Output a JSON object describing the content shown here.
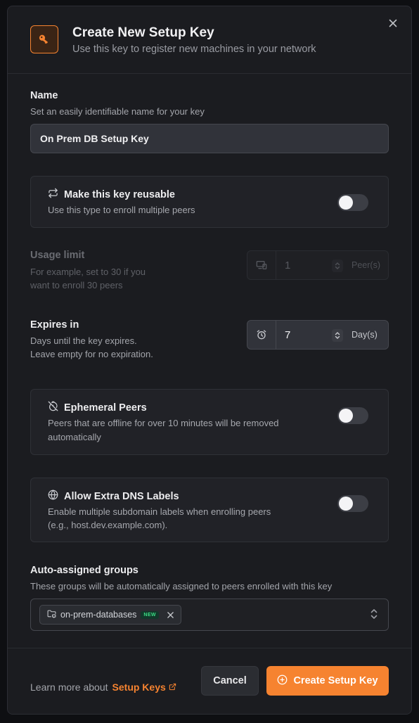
{
  "header": {
    "title": "Create New Setup Key",
    "subtitle": "Use this key to register new machines in your network"
  },
  "name_field": {
    "label": "Name",
    "description": "Set an easily identifiable name for your key",
    "value": "On Prem DB Setup Key"
  },
  "reusable": {
    "title": "Make this key reusable",
    "description": "Use this type to enroll multiple peers",
    "enabled": false
  },
  "usage_limit": {
    "label": "Usage limit",
    "description_line1": "For example, set to 30 if you",
    "description_line2": "want to enroll 30 peers",
    "value": "1",
    "unit": "Peer(s)",
    "disabled": true
  },
  "expires": {
    "label": "Expires in",
    "description_line1": "Days until the key expires.",
    "description_line2": "Leave empty for no expiration.",
    "value": "7",
    "unit": "Day(s)"
  },
  "ephemeral": {
    "title": "Ephemeral Peers",
    "description": "Peers that are offline for over 10 minutes will be removed automatically",
    "enabled": false
  },
  "dns_labels": {
    "title": "Allow Extra DNS Labels",
    "description_line1": "Enable multiple subdomain labels when enrolling peers",
    "description_line2": "(e.g., host.dev.example.com).",
    "enabled": false
  },
  "groups": {
    "label": "Auto-assigned groups",
    "description": "These groups will be automatically assigned to peers enrolled with this key",
    "chips": [
      {
        "name": "on-prem-databases",
        "badge": "NEW"
      }
    ]
  },
  "footer": {
    "learn_prefix": "Learn more about",
    "learn_link": "Setup Keys",
    "cancel_label": "Cancel",
    "create_label": "Create Setup Key"
  },
  "colors": {
    "accent": "#f68330",
    "background": "#1b1c20",
    "new_badge": "#3ddc84"
  }
}
